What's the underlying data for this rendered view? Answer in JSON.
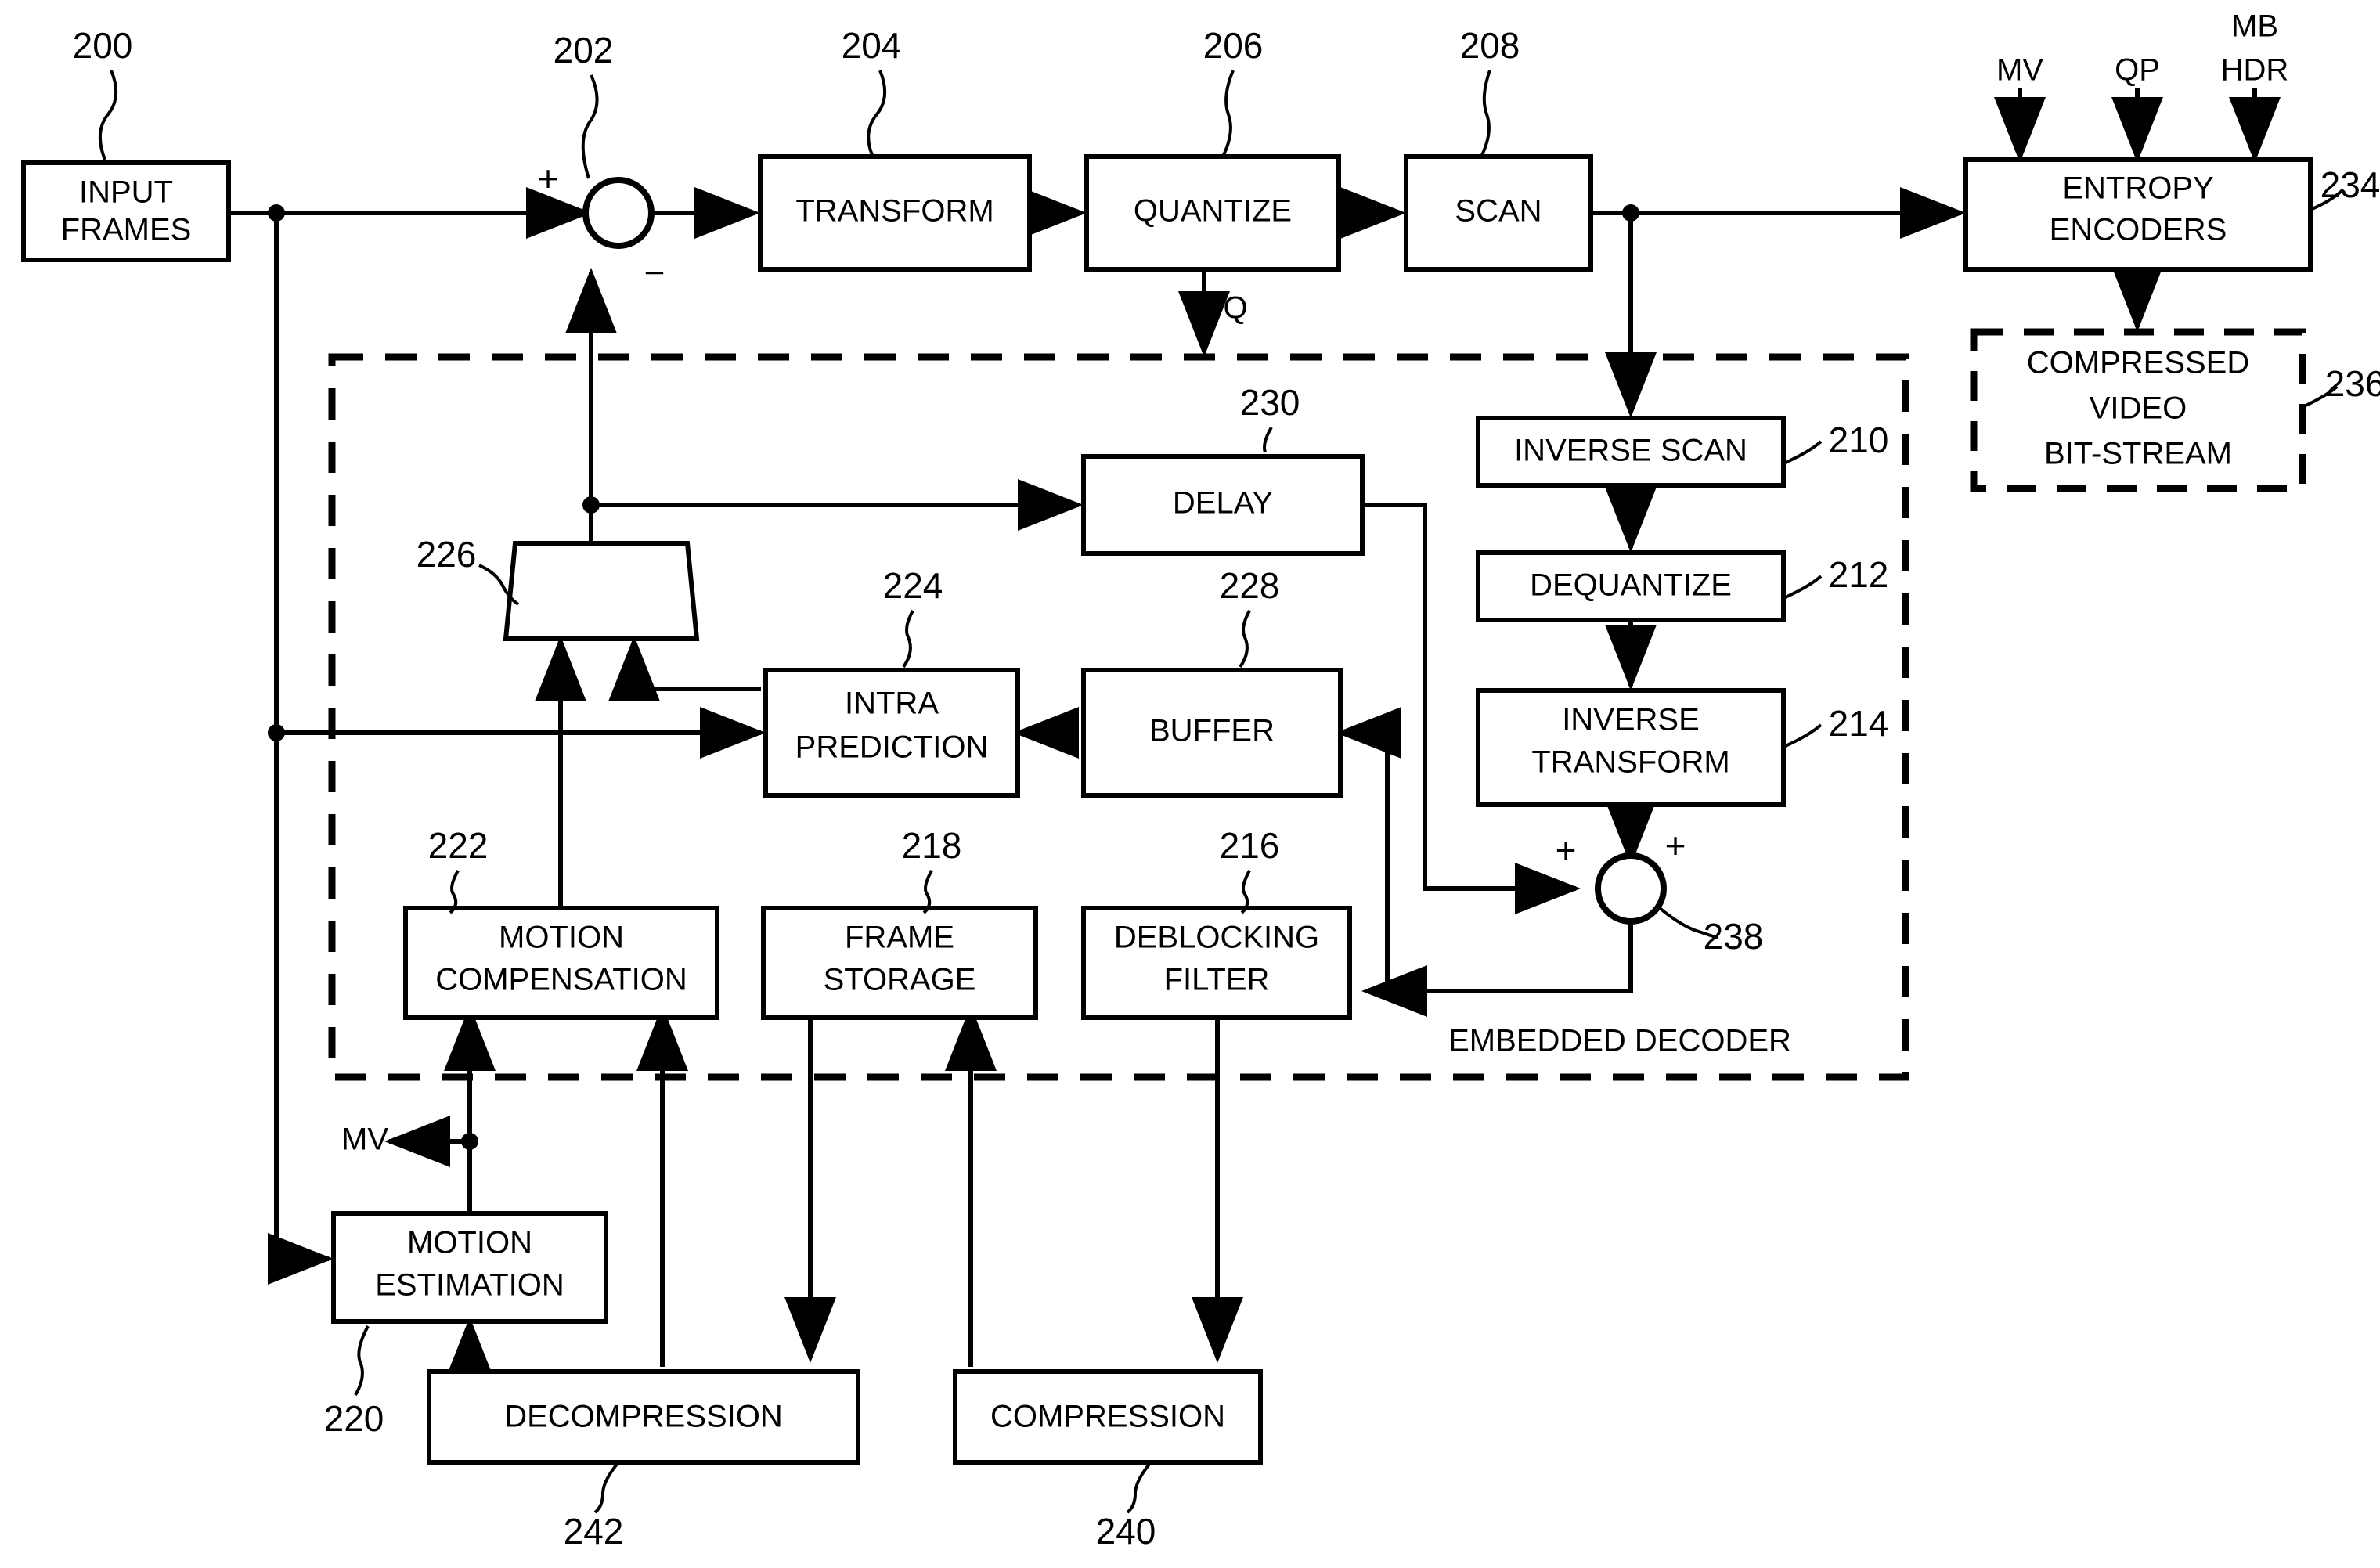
{
  "figure": {
    "type": "video-encoder-block-diagram",
    "group_label": "EMBEDDED DECODER"
  },
  "blocks": [
    {
      "id": "b200",
      "label_lines": [
        "INPUT",
        "FRAMES"
      ],
      "ref": "200",
      "style": "solid"
    },
    {
      "id": "b204",
      "label_lines": [
        "TRANSFORM"
      ],
      "ref": "204",
      "style": "solid"
    },
    {
      "id": "b206",
      "label_lines": [
        "QUANTIZE"
      ],
      "ref": "206",
      "style": "solid"
    },
    {
      "id": "b208",
      "label_lines": [
        "SCAN"
      ],
      "ref": "208",
      "style": "solid"
    },
    {
      "id": "b234",
      "label_lines": [
        "ENTROPY",
        "ENCODERS"
      ],
      "ref": "234",
      "style": "solid"
    },
    {
      "id": "b236",
      "label_lines": [
        "COMPRESSED",
        "VIDEO",
        "BIT-STREAM"
      ],
      "ref": "236",
      "style": "dashed"
    },
    {
      "id": "b210",
      "label_lines": [
        "INVERSE SCAN"
      ],
      "ref": "210",
      "style": "solid"
    },
    {
      "id": "b212",
      "label_lines": [
        "DEQUANTIZE"
      ],
      "ref": "212",
      "style": "solid"
    },
    {
      "id": "b214",
      "label_lines": [
        "INVERSE",
        "TRANSFORM"
      ],
      "ref": "214",
      "style": "solid"
    },
    {
      "id": "b230",
      "label_lines": [
        "DELAY"
      ],
      "ref": "230",
      "style": "solid"
    },
    {
      "id": "b224",
      "label_lines": [
        "INTRA",
        "PREDICTION"
      ],
      "ref": "224",
      "style": "solid"
    },
    {
      "id": "b228",
      "label_lines": [
        "BUFFER"
      ],
      "ref": "228",
      "style": "solid"
    },
    {
      "id": "b222",
      "label_lines": [
        "MOTION",
        "COMPENSATION"
      ],
      "ref": "222",
      "style": "solid"
    },
    {
      "id": "b218",
      "label_lines": [
        "FRAME",
        "STORAGE"
      ],
      "ref": "218",
      "style": "solid"
    },
    {
      "id": "b216",
      "label_lines": [
        "DEBLOCKING",
        "FILTER"
      ],
      "ref": "216",
      "style": "solid"
    },
    {
      "id": "b220",
      "label_lines": [
        "MOTION",
        "ESTIMATION"
      ],
      "ref": "220",
      "style": "solid"
    },
    {
      "id": "b242",
      "label_lines": [
        "DECOMPRESSION"
      ],
      "ref": "242",
      "style": "solid"
    },
    {
      "id": "b240",
      "label_lines": [
        "COMPRESSION"
      ],
      "ref": "240",
      "style": "solid"
    },
    {
      "id": "mux226",
      "label_lines": [],
      "ref": "226",
      "style": "trapezoid"
    }
  ],
  "junctions": [
    {
      "id": "j202",
      "ref": "202",
      "kind": "summing",
      "signs": [
        "+",
        "-"
      ]
    },
    {
      "id": "j238",
      "ref": "238",
      "kind": "summing",
      "signs": [
        "+",
        "+"
      ]
    }
  ],
  "signals": {
    "mv_top": "MV",
    "qp": "QP",
    "mb": "MB",
    "hdr": "HDR",
    "q": "Q",
    "mv_bottom": "MV"
  },
  "refs": {
    "r200": "200",
    "r202": "202",
    "r204": "204",
    "r206": "206",
    "r208": "208",
    "r210": "210",
    "r212": "212",
    "r214": "214",
    "r216": "216",
    "r218": "218",
    "r220": "220",
    "r222": "222",
    "r224": "224",
    "r226": "226",
    "r228": "228",
    "r230": "230",
    "r234": "234",
    "r236": "236",
    "r238": "238",
    "r240": "240",
    "r242": "242"
  },
  "labels": {
    "input_frames_1": "INPUT",
    "input_frames_2": "FRAMES",
    "transform": "TRANSFORM",
    "quantize": "QUANTIZE",
    "scan": "SCAN",
    "entropy_1": "ENTROPY",
    "entropy_2": "ENCODERS",
    "bitstream_1": "COMPRESSED",
    "bitstream_2": "VIDEO",
    "bitstream_3": "BIT-STREAM",
    "inverse_scan": "INVERSE SCAN",
    "dequantize": "DEQUANTIZE",
    "inverse_transform_1": "INVERSE",
    "inverse_transform_2": "TRANSFORM",
    "delay": "DELAY",
    "intra_1": "INTRA",
    "intra_2": "PREDICTION",
    "buffer": "BUFFER",
    "motion_comp_1": "MOTION",
    "motion_comp_2": "COMPENSATION",
    "frame_storage_1": "FRAME",
    "frame_storage_2": "STORAGE",
    "deblocking_1": "DEBLOCKING",
    "deblocking_2": "FILTER",
    "motion_est_1": "MOTION",
    "motion_est_2": "ESTIMATION",
    "decompression": "DECOMPRESSION",
    "compression": "COMPRESSION",
    "embedded_decoder": "EMBEDDED DECODER",
    "plus1": "+",
    "minus1": "−",
    "plus2": "+",
    "plus3": "+"
  },
  "colors": {
    "stroke": "#000000",
    "fill": "#ffffff"
  }
}
